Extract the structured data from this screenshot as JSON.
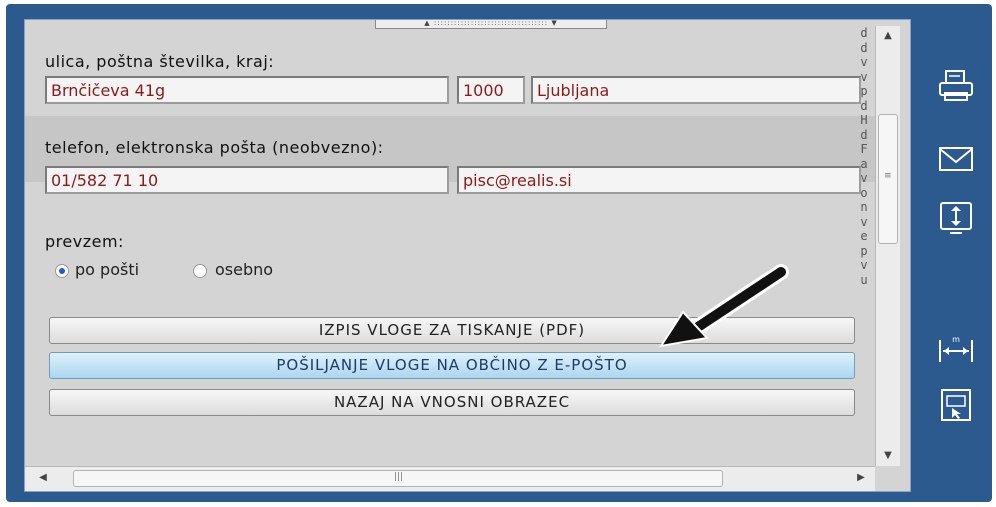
{
  "address": {
    "label": "ulica, poštna številka, kraj:",
    "street": "Brnčičeva 41g",
    "postal_code": "1000",
    "city": "Ljubljana"
  },
  "contact": {
    "label": "telefon, elektronska pošta (neobvezno):",
    "phone": "01/582 71 10",
    "email": "pisc@realis.si"
  },
  "pickup": {
    "label": "prevzem:",
    "options": [
      {
        "label": "po pošti",
        "checked": true
      },
      {
        "label": "osebno",
        "checked": false
      }
    ]
  },
  "buttons": {
    "print": "IZPIS VLOGE ZA TISKANJE (PDF)",
    "send": "POŠILJANJE VLOGE NA OBČINO Z E-POŠTO",
    "back": "NAZAJ NA VNOSNI OBRAZEC"
  },
  "side_letters": "ddvvpdHdFavonvepvu",
  "colors": {
    "frame": "#2c5a8e",
    "panel": "#d4d4d4",
    "input_text": "#8b1a1a",
    "primary_button": "#aad6ef"
  },
  "toolbar_icons": [
    "printer-icon",
    "mail-icon",
    "fit-height-icon",
    "fit-width-icon",
    "zoom-icon"
  ]
}
